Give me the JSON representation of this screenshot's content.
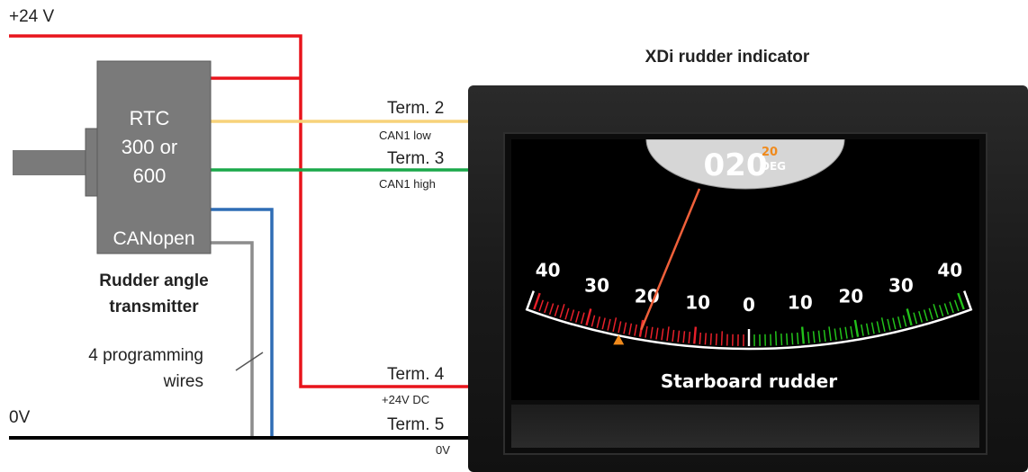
{
  "supply": {
    "plus24": "+24 V",
    "zero": "0V"
  },
  "transmitter": {
    "line1": "RTC",
    "line2": "300 or",
    "line3": "600",
    "protocol": "CANopen",
    "caption1": "Rudder angle",
    "caption2": "transmitter"
  },
  "programming": {
    "line1": "4 programming",
    "line2": "wires"
  },
  "terminals": [
    {
      "label": "Term. 2",
      "sub": "CAN1 low"
    },
    {
      "label": "Term. 3",
      "sub": "CAN1 high"
    },
    {
      "label": "Term. 4",
      "sub": "+24V DC"
    },
    {
      "label": "Term. 5",
      "sub": "0V"
    }
  ],
  "indicator": {
    "title": "XDi rudder indicator",
    "readout_value": "020",
    "readout_small": "20",
    "readout_unit": "DEG",
    "scale_label": "Starboard rudder",
    "ticks": [
      "40",
      "30",
      "20",
      "10",
      "0",
      "10",
      "20",
      "30",
      "40"
    ],
    "angle_deg": 20
  },
  "colors": {
    "red_wire": "#e8141b",
    "yellow_wire": "#f7d27a",
    "green_wire": "#1aa84a",
    "blue_wire": "#2f6db5",
    "grey_wire": "#8c8c8c",
    "black_wire": "#000000",
    "port_scale": "#e8202a",
    "starboard_scale": "#22c21a",
    "accent_orange": "#f08a1c"
  }
}
